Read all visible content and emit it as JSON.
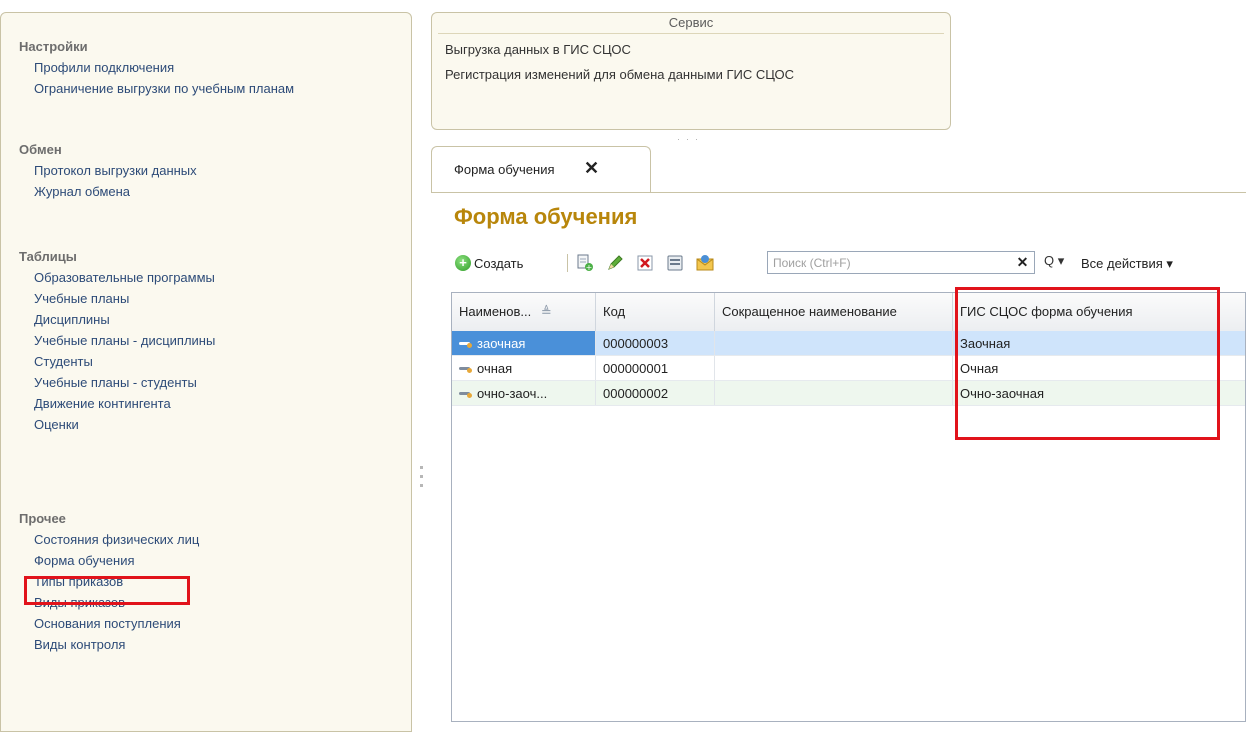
{
  "nav": {
    "sections": [
      {
        "title": "Настройки",
        "items": [
          "Профили подключения",
          "Ограничение выгрузки по учебным планам"
        ]
      },
      {
        "title": "Обмен",
        "items": [
          "Протокол выгрузки данных",
          "Журнал обмена"
        ]
      },
      {
        "title": "Таблицы",
        "items": [
          "Образовательные программы",
          "Учебные планы",
          "Дисциплины",
          "Учебные планы - дисциплины",
          "Студенты",
          "Учебные планы - студенты",
          "Движение контингента",
          "Оценки"
        ]
      },
      {
        "title": "Прочее",
        "items": [
          "Состояния физических лиц",
          "Форма обучения",
          "Типы приказов",
          "Виды приказов",
          "Основания поступления",
          "Виды контроля"
        ]
      }
    ],
    "selected": "Форма обучения"
  },
  "service": {
    "title": "Сервис",
    "items": [
      "Выгрузка данных в ГИС СЦОС",
      "Регистрация изменений для обмена данными ГИС СЦОС"
    ]
  },
  "tab": {
    "label": "Форма обучения",
    "close": "✕"
  },
  "form": {
    "title": "Форма обучения",
    "toolbar": {
      "create_label": "Создать",
      "search_placeholder": "Поиск (Ctrl+F)",
      "search_clear": "✕",
      "search_go": "Q ▾",
      "all_actions": "Все действия ▾"
    },
    "grid": {
      "columns": [
        "Наименов...",
        "Код",
        "Сокращенное наименование",
        "ГИС СЦОС форма обучения"
      ],
      "rows": [
        {
          "name": "заочная",
          "code": "000000003",
          "short": "",
          "gis": "Заочная"
        },
        {
          "name": "очная",
          "code": "000000001",
          "short": "",
          "gis": "Очная"
        },
        {
          "name": "очно-заоч...",
          "code": "000000002",
          "short": "",
          "gis": "Очно-заочная"
        }
      ]
    }
  },
  "colors": {
    "accent_title": "#b8860b",
    "highlight": "#e1131b",
    "selected_row": "#cfe4fb",
    "link": "#2d4b78"
  }
}
